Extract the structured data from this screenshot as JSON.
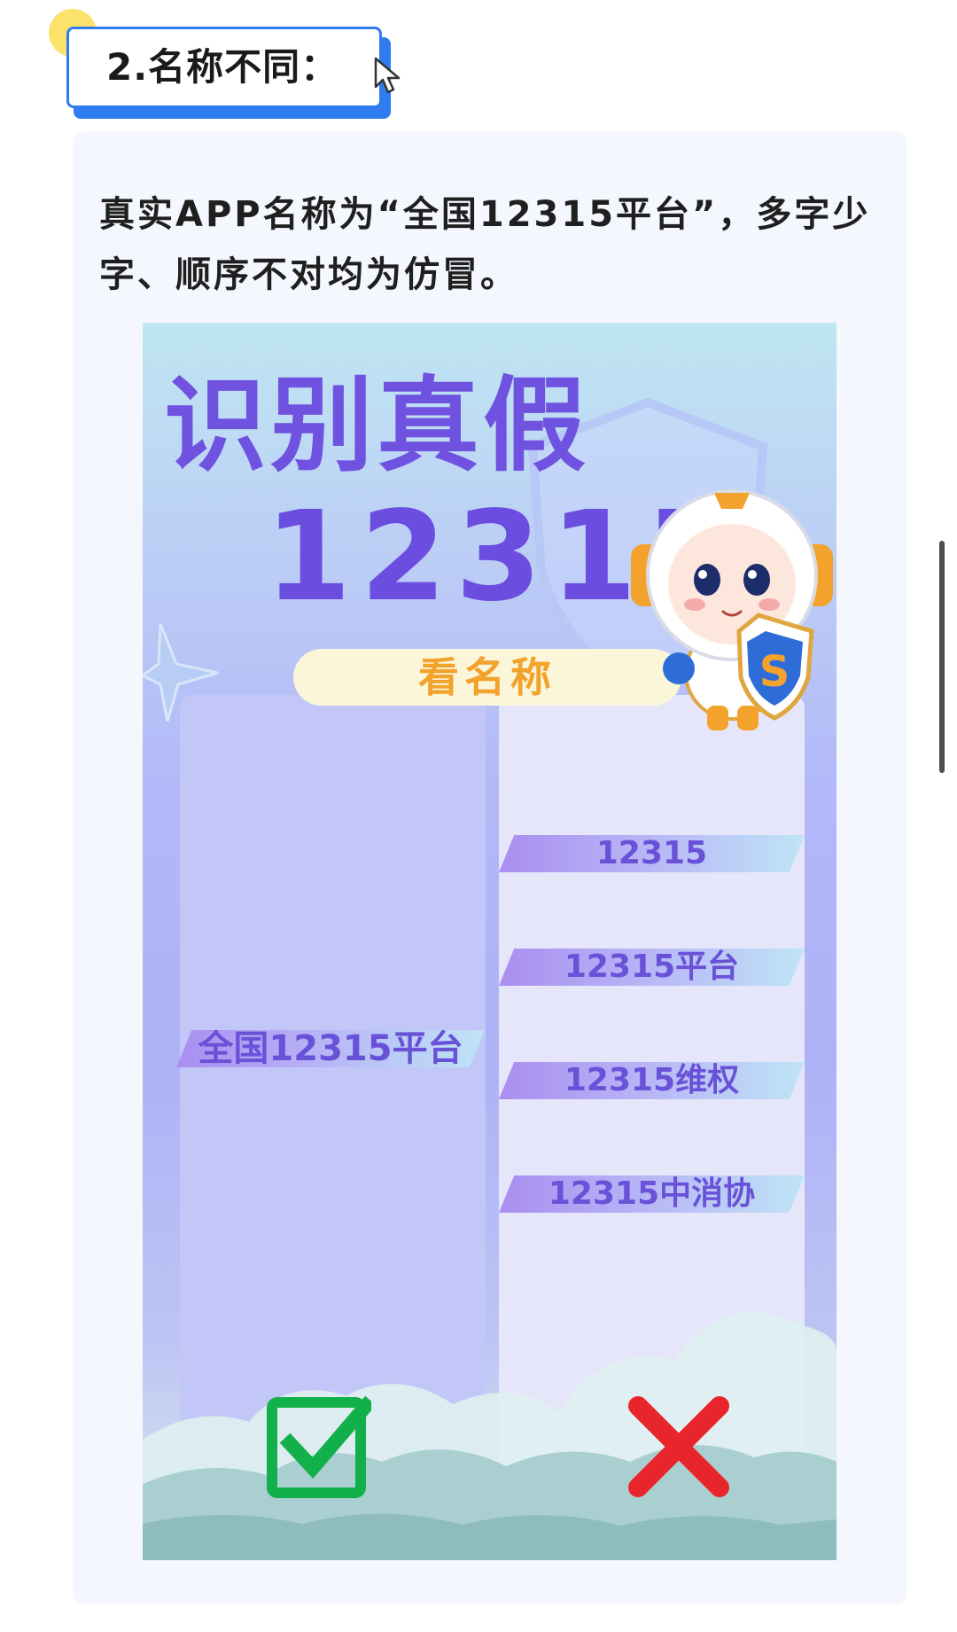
{
  "section": {
    "title": "2.名称不同："
  },
  "description": {
    "text": "真实APP名称为“全国12315平台”，多字少字、顺序不对均为仿冒。"
  },
  "poster": {
    "title": "识别真假",
    "number": "12315",
    "subtitle": "看名称",
    "real_name": "全国12315平台",
    "fake_names": [
      "12315",
      "12315平台",
      "12315维权",
      "12315中消协"
    ],
    "mascot_badge": "S",
    "check_icon": "check-icon",
    "cross_icon": "cross-icon"
  },
  "colors": {
    "accent_blue": "#2f7cf0",
    "title_purple": "#6b4ee0",
    "pill_orange": "#f3a22c",
    "check_green": "#12b04a",
    "cross_red": "#e8252b"
  }
}
